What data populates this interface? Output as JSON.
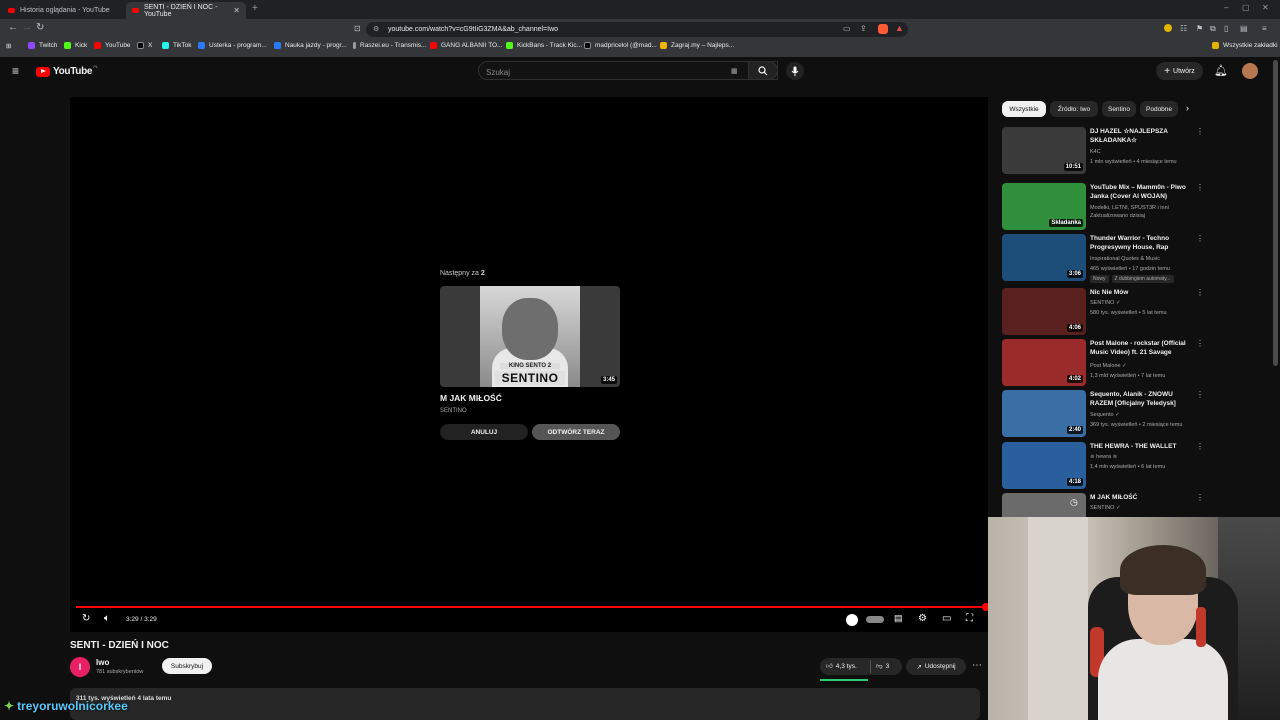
{
  "browser": {
    "tabs": [
      {
        "label": "Historia oglądania - YouTube",
        "active": false
      },
      {
        "label": "SENTI - DZIEŃ I NOC - YouTube",
        "active": true
      }
    ],
    "url": "youtube.com/watch?v=cG9tIiG3ZMA&ab_channel=Iwo",
    "bookmarks": [
      "Twitch",
      "Kick",
      "YouTube",
      "X",
      "TikTok",
      "Usterka - program...",
      "Nauka jazdy - progr...",
      "Raszei.eu - Transmis...",
      "GANG ALBANII TO...",
      "KickBans - Track Kic...",
      "madpricelol (@mad...",
      "Zagraj.my – Najleps..."
    ],
    "all_bookmarks": "Wszystkie zakładki"
  },
  "masthead": {
    "logo_text": "YouTube",
    "logo_region": "PL",
    "search_placeholder": "Szukaj",
    "create_label": "Utwórz"
  },
  "player": {
    "upnext_prefix": "Następny za",
    "upnext_count": "2",
    "upnext_title": "M JAK MIŁOŚĆ",
    "upnext_channel": "SENTINO",
    "upnext_duration": "3:45",
    "thumb_text_small": "KING SENTO 2",
    "thumb_text_big": "SENTINO",
    "cancel_label": "ANULUJ",
    "play_now_label": "ODTWÓRZ TERAZ",
    "time": "3:29 / 3:29",
    "progress": 1.0
  },
  "video": {
    "title": "SENTI - DZIEŃ I NOC",
    "channel": "Iwo",
    "avatar_letter": "I",
    "subscribers": "781 subskrybentów",
    "subscribe_label": "Subskrybuj",
    "likes": "4,3 tys.",
    "dislikes": "3",
    "share_label": "Udostępnij",
    "views": "311 tys. wyświetleń  4 lata temu"
  },
  "sidebar": {
    "chips": [
      "Wszystkie",
      "Źródło: Iwo",
      "Sentino",
      "Podobne"
    ],
    "recs": [
      {
        "title": "DJ HAZEL ☆NAJLEPSZA SKŁADANKA☆",
        "channel": "K4C",
        "meta": "1 mln wyświetleń • 4 miesiące temu",
        "duration": "10:51",
        "color": "#3a3a3a"
      },
      {
        "title": "YouTube Mix – Mamm0n - Piwo Janka (Cover AI WOJAN)",
        "channel": "Modelki, LETNI, SPUST3R i inni",
        "meta": "Zaktualizowano dzisiaj",
        "duration": "Składanka",
        "color": "#2f8f3a"
      },
      {
        "title": "Thunder Warrior - Techno Progresywny House, Rap",
        "channel": "Inspirational Quotes & Music",
        "meta": "465 wyświetleń • 17 godzin temu",
        "badges": [
          "Nowy",
          "Z dubbingiem automaty..."
        ],
        "duration": "3:06",
        "color": "#1d4e7a"
      },
      {
        "title": "Nic Nie Mów",
        "channel": "SENTINO",
        "meta": "580 tys. wyświetleń • 5 lat temu",
        "duration": "4:06",
        "color": "#5a1f1f"
      },
      {
        "title": "Post Malone - rockstar (Official Music Video) ft. 21 Savage",
        "channel": "Post Malone",
        "meta": "1,3 mld wyświetleń • 7 lat temu",
        "duration": "4:02",
        "color": "#9b2a2a"
      },
      {
        "title": "Sequento, Alanik - ZNOWU RAZEM [Oficjalny Teledysk]",
        "channel": "Sequento",
        "meta": "369 tys. wyświetleń • 2 miesiące temu",
        "duration": "2:40",
        "color": "#3a6ea5"
      },
      {
        "title": "THE HEWRA - THE WALLET",
        "channel": "≋ hewra ≋",
        "meta": "1,4 mln wyświetleń • 6 lat temu",
        "duration": "4:18",
        "color": "#2a5f9e"
      },
      {
        "title": "M JAK MIŁOŚĆ",
        "channel": "SENTINO",
        "meta": "",
        "duration": "",
        "color": "#6b6b6b"
      }
    ]
  },
  "overlay": {
    "username": "treyoruwolnicorkee"
  }
}
